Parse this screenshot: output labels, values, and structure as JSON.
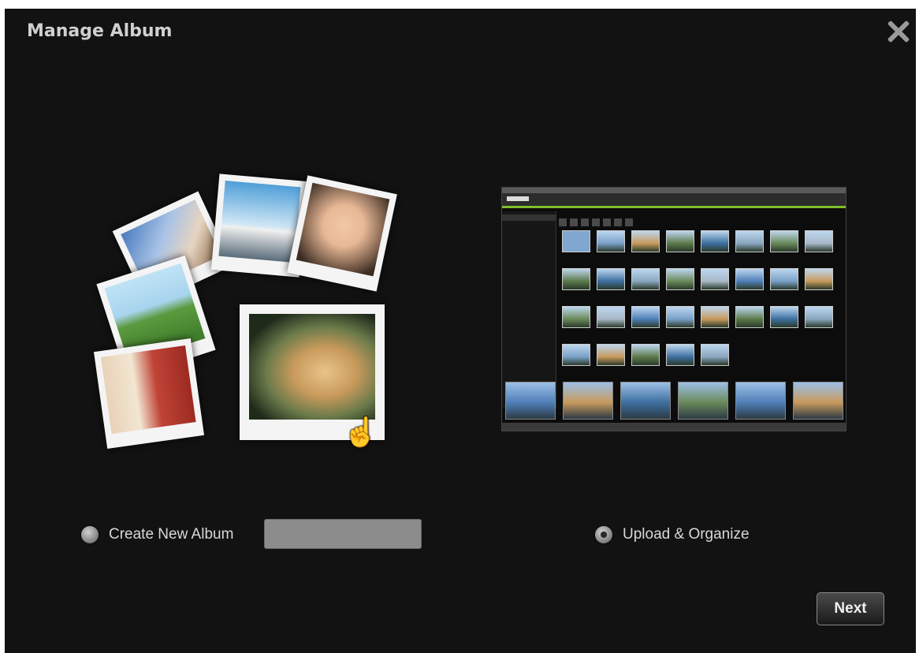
{
  "dialog": {
    "title": "Manage Album",
    "close_icon": "close-icon"
  },
  "options": {
    "create_new_album": {
      "label": "Create New Album",
      "selected": false,
      "input_value": "",
      "input_placeholder": ""
    },
    "upload_organize": {
      "label": "Upload & Organize",
      "selected": true
    }
  },
  "buttons": {
    "next_label": "Next"
  },
  "colors": {
    "background": "#121212",
    "text": "#d8d8d8",
    "accent": "#7fbf2a"
  }
}
